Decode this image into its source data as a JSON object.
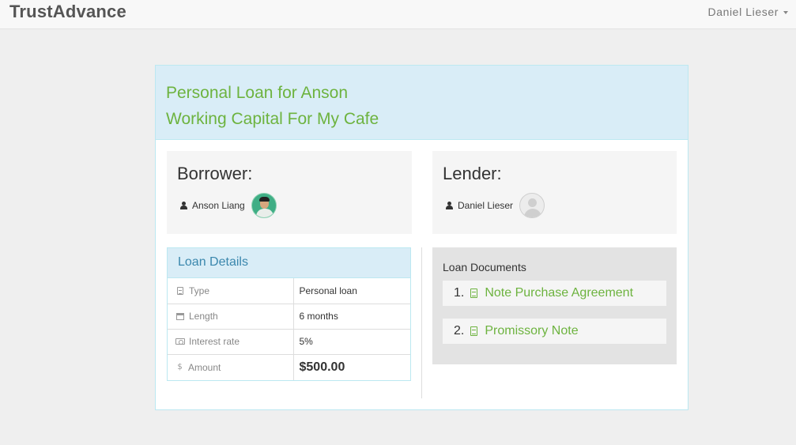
{
  "navbar": {
    "brand": "TrustAdvance",
    "user_name": "Daniel Lieser",
    "user_menu_icon": "caret-down-icon"
  },
  "loan": {
    "title_line1": "Personal Loan for Anson",
    "title_line2": "Working Capital For My Cafe"
  },
  "borrower": {
    "heading": "Borrower:",
    "name": "Anson Liang",
    "icon": "user-icon",
    "avatar": "borrower-photo"
  },
  "lender": {
    "heading": "Lender:",
    "name": "Daniel Lieser",
    "icon": "user-icon",
    "avatar": "default-avatar"
  },
  "details": {
    "heading": "Loan Details",
    "rows": [
      {
        "label": "Type",
        "value": "Personal loan",
        "icon": "document-icon"
      },
      {
        "label": "Length",
        "value": "6 months",
        "icon": "calendar-icon"
      },
      {
        "label": "Interest rate",
        "value": "5%",
        "icon": "money-icon"
      },
      {
        "label": "Amount",
        "value": "$500.00",
        "icon": "dollar-icon"
      }
    ]
  },
  "documents": {
    "heading": "Loan Documents",
    "items": [
      {
        "number": "1.",
        "label": "Note Purchase Agreement",
        "icon": "file-icon"
      },
      {
        "number": "2.",
        "label": "Promissory Note",
        "icon": "file-icon"
      }
    ]
  },
  "colors": {
    "accent_green": "#6db33f",
    "info_bg": "#d9edf7",
    "info_border": "#bce8f1",
    "info_text": "#3a87ad"
  }
}
